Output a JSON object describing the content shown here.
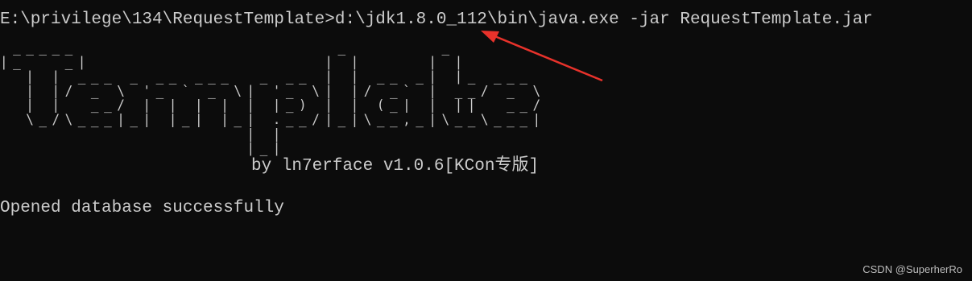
{
  "console": {
    "command_line": "E:\\privilege\\134\\RequestTemplate>d:\\jdk1.8.0_112\\bin\\java.exe -jar RequestTemplate.jar",
    "banner_lines": [
      " _____                    _       _",
      "|_   _|                  | |     | |",
      "  | | ___ _ __ ___  _ __ | | __ _| |_ ___",
      "  | |/ _ \\ '_ ` _ \\| '_ \\| |/ _` | __/ _ \\",
      "  | |  __/ | | | | | |_) | | (_| | ||  __/",
      "  \\_/\\___|_| |_| |_| .__/|_|\\__,_|\\__\\___|",
      "                   | |",
      "                   |_|"
    ],
    "byline": "by ln7erface v1.0.6[KCon专版]",
    "status": "Opened database successfully"
  },
  "annotation": {
    "arrow_color": "#e8322b"
  },
  "watermark": "CSDN @SuperherRo"
}
